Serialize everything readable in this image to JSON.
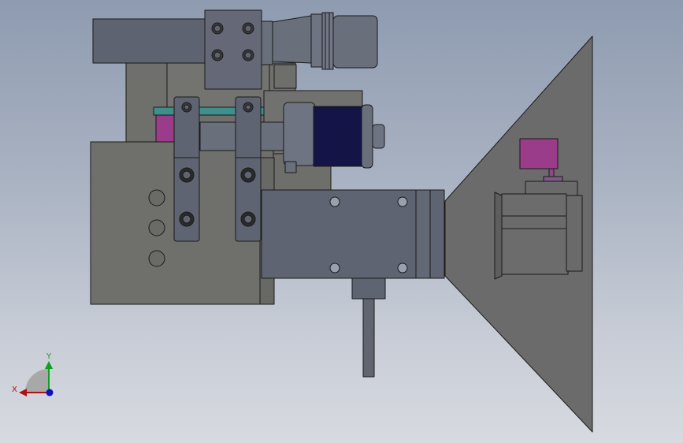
{
  "triad": {
    "x_label": "X",
    "y_label": "Y",
    "x_color": "#b01010",
    "y_color": "#10a020",
    "z_color": "#1010c0"
  },
  "colors": {
    "body_dark": "#6e6e6b",
    "body_mid": "#747470",
    "steel": "#5f6472",
    "steel_light": "#6a6f7c",
    "magenta": "#9a3c8a",
    "motor_blue": "#141446",
    "teal": "#3f8f8c",
    "cone": "#6c6c6c",
    "edge": "#1a1a1a"
  }
}
